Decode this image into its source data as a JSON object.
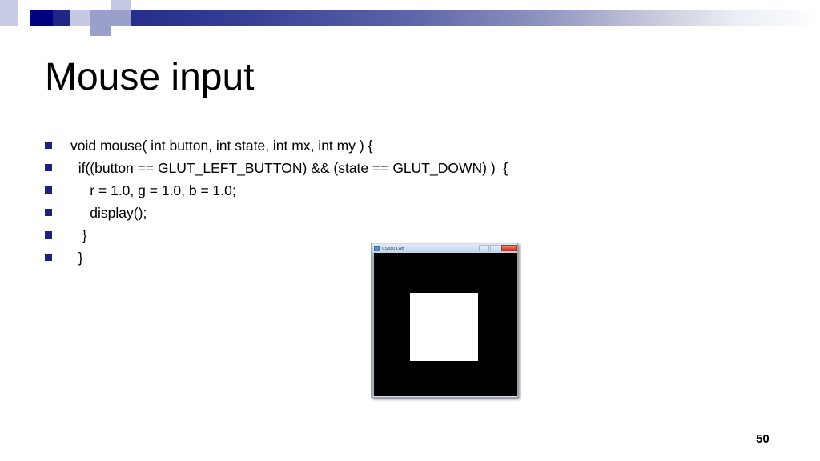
{
  "slide": {
    "title": "Mouse input",
    "number": "50"
  },
  "code_lines": [
    {
      "text": "void mouse( int button, int state, int mx, int my ) {"
    },
    {
      "text": "  if((button == GLUT_LEFT_BUTTON) && (state == GLUT_DOWN) )  {"
    },
    {
      "text": "     r = 1.0, g = 1.0, b = 1.0;"
    },
    {
      "text": "     display();"
    },
    {
      "text": "   }"
    },
    {
      "text": "  }"
    }
  ],
  "app_window": {
    "title": "CS380 LAB",
    "icon": "app-icon",
    "controls": {
      "minimize": "minimize",
      "maximize": "maximize",
      "close": "close"
    },
    "canvas": {
      "background_color": "#000000",
      "shape_color": "#ffffff",
      "shape": "square"
    }
  },
  "theme": {
    "bullet_color": "#1d2083",
    "header_gradient_start": "#1d2083",
    "header_gradient_end": "#ffffff",
    "accent_navy": "#010080"
  }
}
